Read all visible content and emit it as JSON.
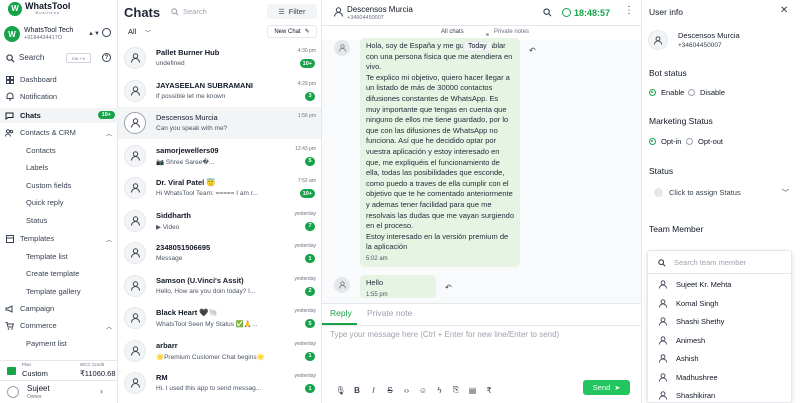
{
  "brand": {
    "name": "WhatsTool",
    "tagline": "Business",
    "logo_letter": "W"
  },
  "account": {
    "name": "WhatsTool Tech",
    "phone": "+9184434417O"
  },
  "sidebar": {
    "search_label": "Search",
    "search_shortcut": "Ctrl + K",
    "items": [
      {
        "label": "Dashboard",
        "icon": "grid-icon"
      },
      {
        "label": "Notification",
        "icon": "bell-icon"
      },
      {
        "label": "Chats",
        "icon": "chat-icon",
        "badge": "10+",
        "active": true
      },
      {
        "label": "Contacts & CRM",
        "icon": "users-icon",
        "expanded": true
      },
      {
        "label": "Templates",
        "icon": "template-icon",
        "expanded": true
      },
      {
        "label": "Campaign",
        "icon": "megaphone-icon"
      },
      {
        "label": "Commerce",
        "icon": "cart-icon",
        "expanded": true
      }
    ],
    "contacts_sub": [
      "Contacts",
      "Labels",
      "Custom fields",
      "Quick reply",
      "Status"
    ],
    "templates_sub": [
      "Template list",
      "Create template",
      "Template gallery"
    ],
    "commerce_sub": [
      "Payment list"
    ]
  },
  "plan": {
    "label": "Plan",
    "value": "Custom",
    "credit_label": "WCC Credit",
    "credit_value": "₹11060.68"
  },
  "user": {
    "name": "Sujeet",
    "role": "Owner"
  },
  "chatlist": {
    "title": "Chats",
    "search_placeholder": "Search",
    "filter_label": "Filter",
    "scope": "All",
    "new_chat": "New Chat",
    "chats": [
      {
        "name": "Pallet Burner Hub",
        "message": "undefined",
        "time": "4:30 pm",
        "badge": "10+"
      },
      {
        "name": "JAYASEELAN SUBRAMANI",
        "message": "If possible let me known",
        "time": "4:29 pm",
        "badge": "3"
      },
      {
        "name": "Descensos Murcia",
        "message": "Can you speak with me?",
        "time": "1:56 pm",
        "badge": "",
        "selected": true
      },
      {
        "name": "samorjewellers09",
        "message": "📷 Shree Saree�...",
        "time": "12:43 pm",
        "badge": "5"
      },
      {
        "name": "Dr. Viral Patel 😇",
        "message": "Hi WhatsTool Team: ===== I am r...",
        "time": "7:52 am",
        "badge": "10+"
      },
      {
        "name": "Siddharth",
        "message": "▶ Video",
        "time": "yesterday",
        "badge": "7"
      },
      {
        "name": "2348051506695",
        "message": "Message",
        "time": "yesterday",
        "badge": "1"
      },
      {
        "name": "Samson (U.Vinci's Assit)",
        "message": "Hello, How are you doin today? I...",
        "time": "yesterday",
        "badge": "2"
      },
      {
        "name": "Black Heart 🖤🐚",
        "message": "WhatsTool Seen My Status ✅🙏...",
        "time": "yesterday",
        "badge": "5"
      },
      {
        "name": "arbarr",
        "message": "🌟Premium Customer Chat begins🌟",
        "time": "yesterday",
        "badge": "1"
      },
      {
        "name": "RM",
        "message": "Hi. I used this app to send messag...",
        "time": "yesterday",
        "badge": "1"
      }
    ]
  },
  "conversation": {
    "contact_name": "Descensos Murcia",
    "contact_phone": "+34604450007",
    "timer": "18:48:57",
    "tab_all": "All chats",
    "tab_notes": "Private notes",
    "day_chip": "Today",
    "messages": [
      {
        "text": "Hola, soy de España y me gustaría hablar con una persona física que me atendiera en vivo.\nTe explico mi objetivo, quiero hacer llegar a un listado de más de 30000 contactos difusiones constantes de WhatsApp. Es muy importante que tengas en cuenta que ninguno de ellos me tiene guardado, por lo que con las difusiones de WhatsApp no funciona. Así que he decidido optar por vuestra aplicación y estoy interesado en que, me expliquéis el funcionamiento de ella, todas las posibilidades que esconde, como puedo a traves de ella cumplir con el objetivo que te he comentado anteriormente y ademas tener facilidad para que me resolvais las dudas que me vayan surgiendo en el proceso.\nEstoy interesado en la versión premium de la aplicación",
        "time": "5:02 am"
      },
      {
        "text": "Hello",
        "time": "1:55 pm"
      }
    ],
    "composer": {
      "tab_reply": "Reply",
      "tab_note": "Private note",
      "placeholder": "Type your message here (Ctrl + Enter for new line/Enter to send)",
      "send_label": "Send",
      "tools": [
        "microphone-icon",
        "bold-icon",
        "italic-icon",
        "strikethrough-icon",
        "code-icon",
        "emoji-icon",
        "flash-icon",
        "attachment-icon",
        "file-icon",
        "currency-icon"
      ]
    }
  },
  "info_panel": {
    "title": "User info",
    "contact_name": "Descensos Murcia",
    "contact_phone": "+34604450007",
    "bot_status": {
      "title": "Bot status",
      "options": [
        "Enable",
        "Disable"
      ],
      "selected": "Enable"
    },
    "marketing": {
      "title": "Marketing Status",
      "options": [
        "Opt-in",
        "Opt-out"
      ],
      "selected": "Opt-in"
    },
    "status": {
      "title": "Status",
      "placeholder": "Click to assign Status"
    },
    "team": {
      "title": "Team Member",
      "search_placeholder": "Search team member",
      "members": [
        "Sujeet Kr. Mehta",
        "Komal Singh",
        "Shashi Shethy",
        "Animesh",
        "Ashish",
        "Madhushree",
        "Shashikiran"
      ]
    }
  },
  "colors": {
    "accent": "#16a34a",
    "bubble": "#e7f4e4",
    "send": "#22c55e"
  }
}
